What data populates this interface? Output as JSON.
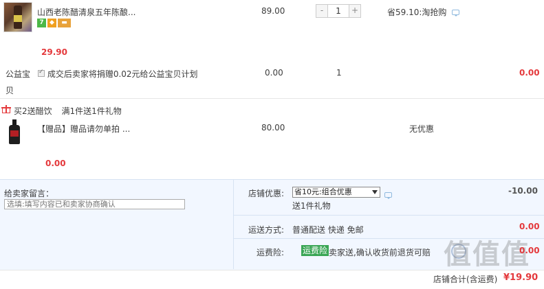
{
  "product1": {
    "title": "山西老陈醋清泉五年陈酿...",
    "unit_price": "89.00",
    "quantity": "1",
    "qty_minus": "-",
    "qty_plus": "+",
    "discount": "省59.10:淘抢购",
    "subtotal": "29.90",
    "badges": [
      {
        "text": "7",
        "color": "#4cb848"
      },
      {
        "text": "◆",
        "color": "#f0a020"
      },
      {
        "text": "▬",
        "color": "#e07a1c"
      }
    ]
  },
  "charity": {
    "label": "公益宝贝",
    "text": "成交后卖家将捐赠0.02元给公益宝贝计划",
    "price": "0.00",
    "quantity": "1",
    "subtotal": "0.00"
  },
  "gift_promo": {
    "label": "买2送醋饮",
    "detail": "满1件送1件礼物"
  },
  "gift_item": {
    "title": "【赠品】赠品请勿单拍 ...",
    "price": "80.00",
    "discount": "无优惠",
    "subtotal": "0.00"
  },
  "seller_message": {
    "label": "给卖家留言：",
    "placeholder": "选填:填写内容已和卖家协商确认"
  },
  "shop_discount": {
    "label": "店铺优惠:",
    "selected": "省10元:组合优惠",
    "note": "送1件礼物",
    "amount": "-10.00"
  },
  "shipping": {
    "label": "运送方式:",
    "method": "普通配送 快递 免邮",
    "amount": "0.00"
  },
  "insurance": {
    "label": "运费险:",
    "tag": "运费险",
    "text": "卖家送,确认收货前退货可赔",
    "amount": "0.00"
  },
  "total": {
    "label": "店铺合计(含运费)",
    "amount": "¥19.90"
  },
  "watermark": "值值值",
  "colors": {
    "accent_red": "#e4393c",
    "panel_bg": "#f2f7ff",
    "insurance_green": "#3aa655"
  }
}
